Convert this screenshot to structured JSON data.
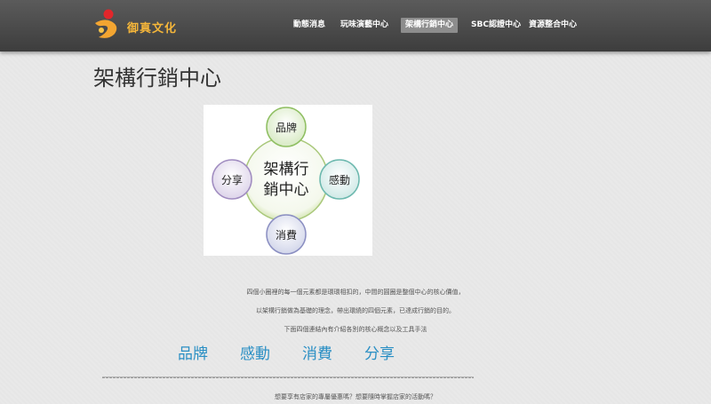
{
  "header": {
    "logo_text": "御真文化",
    "nav": [
      {
        "label": "動態消息"
      },
      {
        "label": "玩味演藝中心"
      },
      {
        "label": "架構行銷中心",
        "active": true
      },
      {
        "label": "SBC認證中心"
      },
      {
        "label": "資源整合中心"
      }
    ]
  },
  "page": {
    "title": "架構行銷中心"
  },
  "diagram": {
    "center_line1": "架構行",
    "center_line2": "銷中心",
    "top": "品牌",
    "right": "感動",
    "bottom": "消費",
    "left": "分享"
  },
  "body_text": {
    "line1": "四個小圈裡的每一個元素都是環環相扣的，中間的圓圈是整個中心的核心價值，",
    "line2": "以架構行銷做為基礎的理念，帶出環繞的四個元素，已達成行銷的目的。",
    "line3": "下面四個連結內有介紹各別的核心概念以及工具手法",
    "bottom_text": "想要享有店家的專屬優惠嗎？想要隨時掌握店家的活動嗎？"
  },
  "links": [
    {
      "label": "品牌"
    },
    {
      "label": "感動"
    },
    {
      "label": "消費"
    },
    {
      "label": "分享"
    }
  ],
  "colors": {
    "link": "#2a8fc4",
    "header_bg": "#4a4a4a",
    "logo_accent": "#f5b63a"
  }
}
